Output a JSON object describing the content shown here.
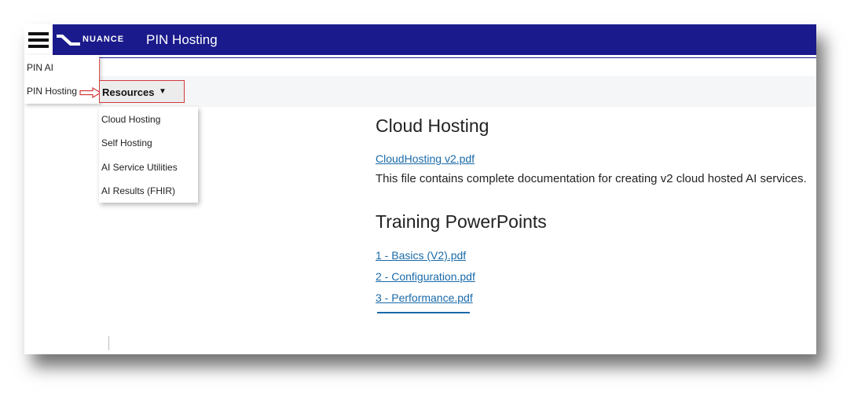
{
  "header": {
    "brand": "NUANCE",
    "title": "PIN Hosting",
    "bar_color": "#1a1a8c"
  },
  "side_menu": {
    "items": [
      {
        "label": "PIN AI"
      },
      {
        "label": "PIN Hosting"
      }
    ]
  },
  "resources_menu": {
    "label": "Resources",
    "caret": "▼",
    "items": [
      {
        "label": "Cloud Hosting"
      },
      {
        "label": "Self Hosting"
      },
      {
        "label": "AI Service Utilities"
      },
      {
        "label": "AI Results (FHIR)"
      }
    ]
  },
  "content": {
    "cloud_heading": "Cloud Hosting",
    "cloud_link": "CloudHosting v2.pdf",
    "cloud_desc": "This file contains complete documentation for creating v2 cloud hosted AI services.",
    "training_heading": "Training PowerPoints",
    "training_links": [
      {
        "label": "1 - Basics (V2).pdf"
      },
      {
        "label": "2 - Configuration.pdf"
      },
      {
        "label": "3 - Performance.pdf"
      }
    ],
    "link_color": "#1a6aa8"
  },
  "annotations": {
    "highlight_color": "#d23a3a",
    "arrow_icon": "outline-arrow-right-icon"
  }
}
